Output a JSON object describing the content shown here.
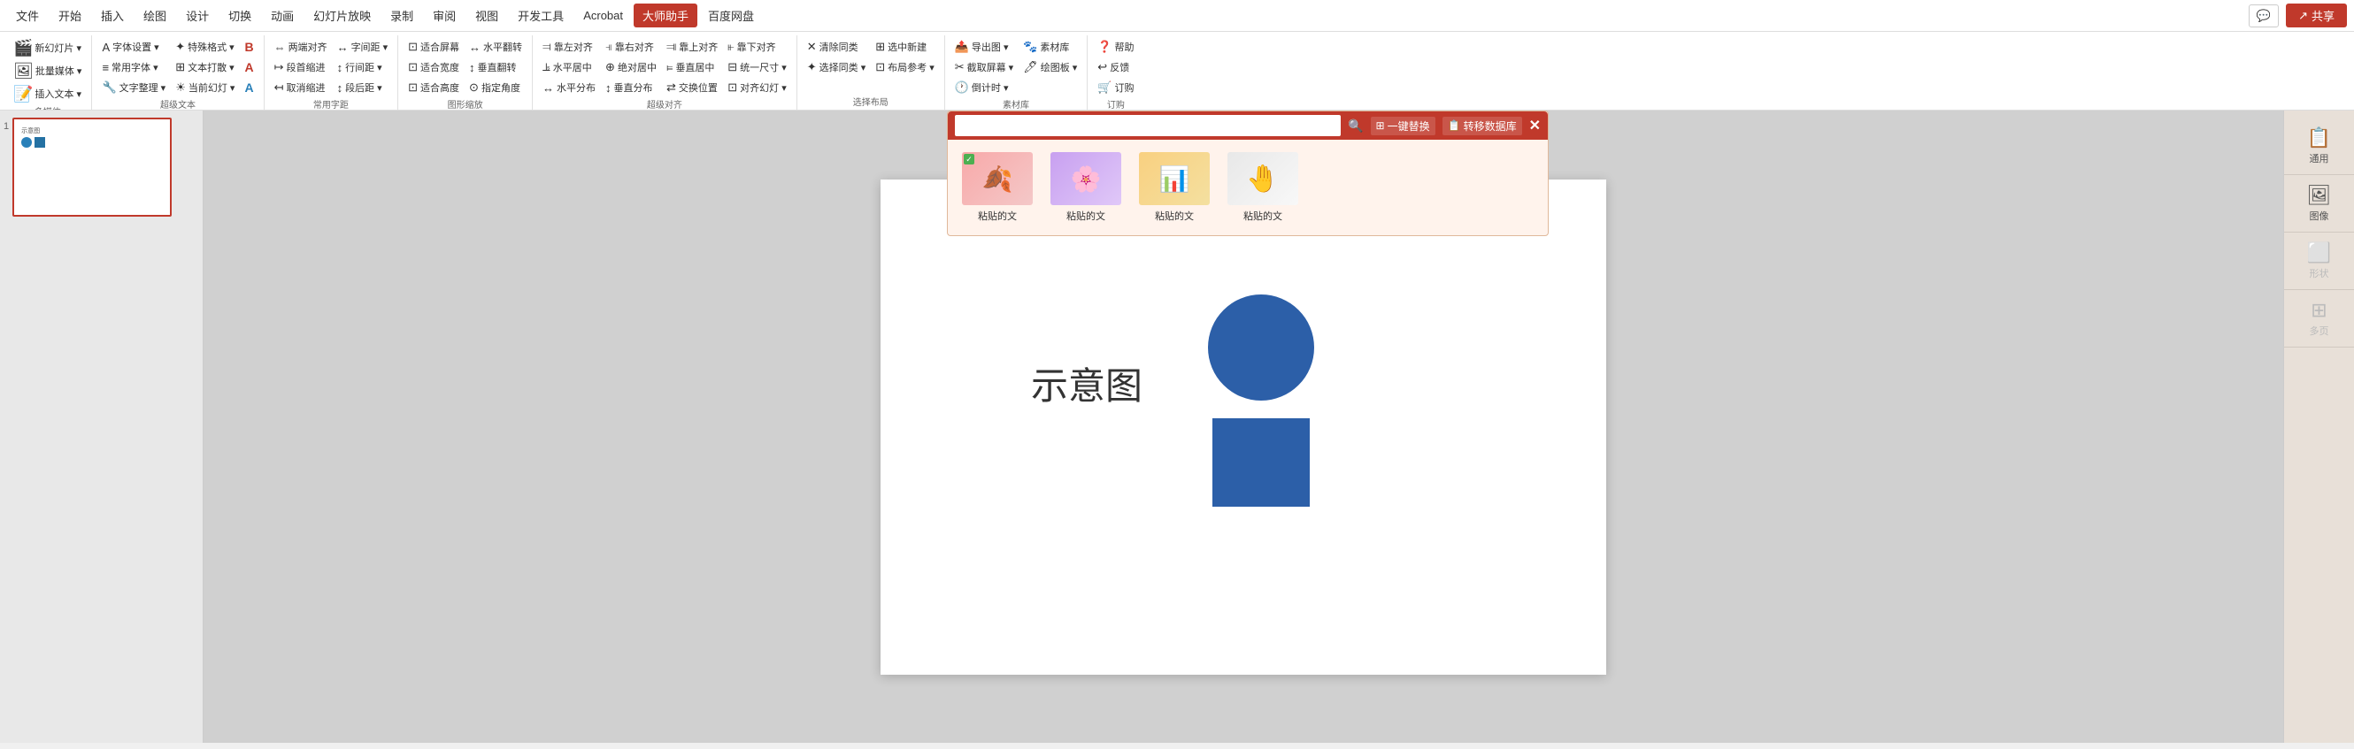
{
  "menu": {
    "items": [
      "文件",
      "开始",
      "插入",
      "绘图",
      "设计",
      "切换",
      "动画",
      "幻灯片放映",
      "录制",
      "审阅",
      "视图",
      "开发工具",
      "Acrobat",
      "大师助手",
      "百度网盘"
    ],
    "active": "大师助手",
    "chat_label": "💬",
    "share_label": "共享"
  },
  "ribbon": {
    "groups": [
      {
        "label": "多媒体",
        "items_big": [
          {
            "icon": "🎬",
            "label": "新幻灯片"
          },
          {
            "icon": "🖼",
            "label": "批量媒体"
          },
          {
            "icon": "📝",
            "label": "插入文本"
          }
        ]
      },
      {
        "label": "超级文本",
        "items_small": [
          {
            "icon": "A",
            "label": "字体设置"
          },
          {
            "icon": "≡",
            "label": "常用字体"
          },
          {
            "icon": "🔧",
            "label": "文字整理"
          },
          {
            "icon": "✦",
            "label": "特殊格式"
          },
          {
            "icon": "⊞",
            "label": "文本打散"
          },
          {
            "icon": "☀",
            "label": "当前幻灯"
          },
          {
            "icon": "B",
            "label": "B",
            "color": "red"
          },
          {
            "icon": "A",
            "label": "A",
            "color": "red"
          },
          {
            "icon": "A",
            "label": "A",
            "color": "blue"
          }
        ]
      },
      {
        "label": "常用字距",
        "items_small": [
          {
            "icon": "⇔",
            "label": "两端对齐"
          },
          {
            "icon": "↕",
            "label": "段首缩进"
          },
          {
            "icon": "✕",
            "label": "取消缩进"
          },
          {
            "icon": "↔",
            "label": "字间距"
          },
          {
            "icon": "↕",
            "label": "行间距"
          },
          {
            "icon": "↕",
            "label": "段后距"
          }
        ]
      },
      {
        "label": "图形缩放",
        "items_small": [
          {
            "icon": "⊡",
            "label": "适合屏幕"
          },
          {
            "icon": "⊡",
            "label": "适合宽度"
          },
          {
            "icon": "⊡",
            "label": "适合高度"
          },
          {
            "icon": "↔",
            "label": "水平翻转"
          },
          {
            "icon": "↕",
            "label": "垂直翻转"
          },
          {
            "icon": "⊙",
            "label": "指定角度"
          }
        ]
      },
      {
        "label": "超级对齐",
        "items_small": [
          {
            "icon": "⫤",
            "label": "靠左对齐"
          },
          {
            "icon": "⫣",
            "label": "靠右对齐"
          },
          {
            "icon": "⫥",
            "label": "靠上对齐"
          },
          {
            "icon": "⫦",
            "label": "靠下对齐"
          },
          {
            "icon": "⫡",
            "label": "水平居中"
          },
          {
            "icon": "⫢",
            "label": "绝对居中"
          },
          {
            "icon": "⫩",
            "label": "垂直居中"
          },
          {
            "icon": "⊟",
            "label": "统一尺寸"
          },
          {
            "icon": "↔",
            "label": "水平分布"
          },
          {
            "icon": "↕",
            "label": "垂直分布"
          },
          {
            "icon": "⇄",
            "label": "交换位置"
          },
          {
            "icon": "⊡",
            "label": "对齐幻灯"
          }
        ]
      },
      {
        "label": "选择布局",
        "items_small": [
          {
            "icon": "✦",
            "label": "清除同类"
          },
          {
            "icon": "⊞",
            "label": "选择同类"
          },
          {
            "icon": "⊡",
            "label": "选中新建"
          }
        ]
      },
      {
        "label": "素材库",
        "items_small": [
          {
            "icon": "📤",
            "label": "导出图"
          },
          {
            "icon": "✂",
            "label": "截取屏幕"
          },
          {
            "icon": "🕐",
            "label": "倒计时"
          },
          {
            "icon": "🐾",
            "label": "素材库"
          },
          {
            "icon": "🖊",
            "label": "绘图板"
          }
        ]
      },
      {
        "label": "订购",
        "items_small": [
          {
            "icon": "❓",
            "label": "帮助"
          },
          {
            "icon": "↩",
            "label": "反馈"
          },
          {
            "icon": "🛒",
            "label": "订购"
          }
        ]
      }
    ]
  },
  "slide_panel": {
    "slide_num": "1"
  },
  "canvas": {
    "label": "示意图"
  },
  "right_panel": {
    "items": [
      {
        "icon": "📋",
        "label": "通用",
        "active": true
      },
      {
        "icon": "🖼",
        "label": "图像"
      },
      {
        "icon": "⬜",
        "label": "形状"
      },
      {
        "icon": "⊞",
        "label": "多页"
      }
    ]
  },
  "floating_panel": {
    "search_placeholder": "",
    "btn1_label": "一键替换",
    "btn2_label": "转移数据库",
    "items": [
      {
        "label": "粘贴的文",
        "type": "pink"
      },
      {
        "label": "粘贴的文",
        "type": "purple"
      },
      {
        "label": "粘贴的文",
        "type": "yellow"
      },
      {
        "label": "粘贴的文",
        "type": "gray"
      }
    ]
  }
}
